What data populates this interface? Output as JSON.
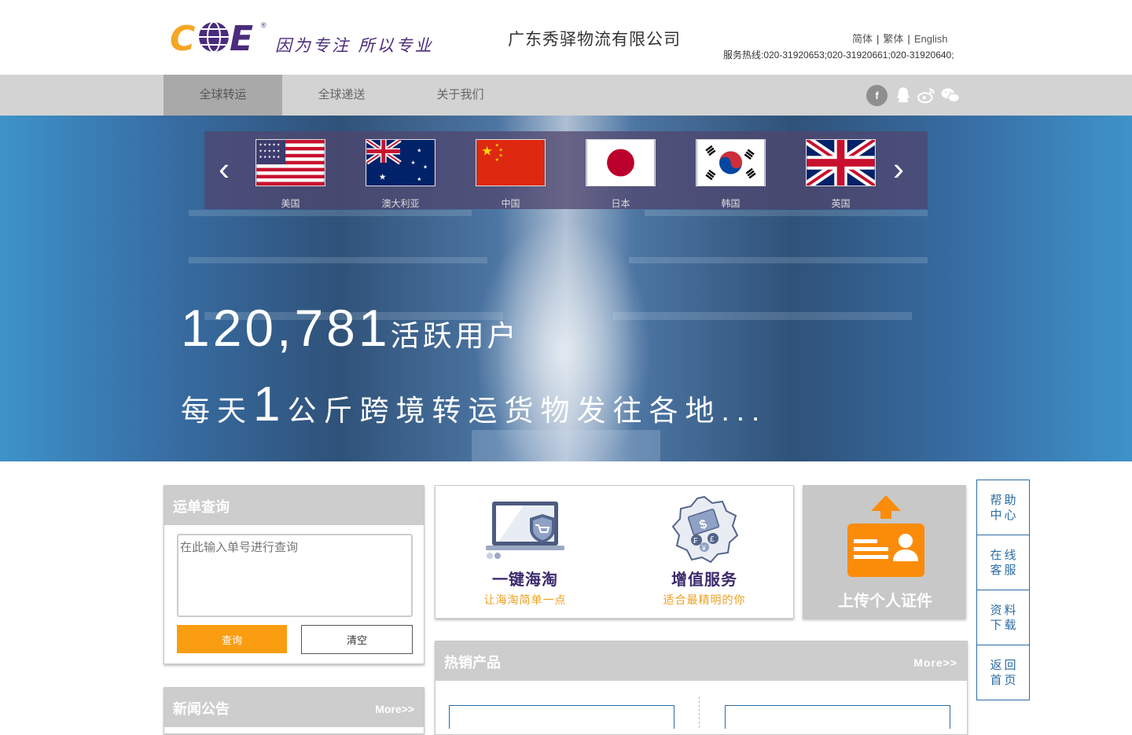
{
  "header": {
    "logo_text": "COE",
    "slogan": "因为专注 所以专业",
    "company_name": "广东秀驿物流有限公司",
    "languages": [
      "简体",
      "繁体",
      "English"
    ],
    "hotline": "服务热线:020-31920653;020-31920661;020-31920640;"
  },
  "nav": {
    "items": [
      "全球转运",
      "全球递送",
      "关于我们"
    ],
    "active_index": 0,
    "social_icons": [
      "facebook-icon",
      "qq-icon",
      "weibo-icon",
      "wechat-icon"
    ]
  },
  "banner": {
    "flags": [
      {
        "label": "美国",
        "icon": "us-flag"
      },
      {
        "label": "澳大利亚",
        "icon": "australia-flag"
      },
      {
        "label": "中国",
        "icon": "china-flag"
      },
      {
        "label": "日本",
        "icon": "japan-flag"
      },
      {
        "label": "韩国",
        "icon": "korea-flag"
      },
      {
        "label": "英国",
        "icon": "uk-flag"
      }
    ],
    "active_users": "120,781",
    "active_users_label": "活跃用户",
    "daily_prefix": "每天",
    "daily_number": "1",
    "daily_suffix": "公斤跨境转运货物发往各地..."
  },
  "tracking": {
    "title": "运单查询",
    "placeholder": "在此输入单号进行查询",
    "query_label": "查询",
    "clear_label": "清空"
  },
  "news": {
    "title": "新闻公告",
    "more_label": "More>>"
  },
  "services": [
    {
      "title": "一键海淘",
      "subtitle": "让海淘简单一点",
      "icon": "laptop-cart-icon"
    },
    {
      "title": "增值服务",
      "subtitle": "适合最精明的你",
      "icon": "currency-badge-icon"
    }
  ],
  "upload": {
    "label": "上传个人证件",
    "icon": "id-card-upload-icon"
  },
  "hot_products": {
    "title": "热销产品",
    "more_label": "More>>"
  },
  "side_bar": {
    "items": [
      "帮助中心",
      "在线客服",
      "资料下载",
      "返回首页"
    ]
  },
  "colors": {
    "brand_purple": "#4a2c7c",
    "accent_orange": "#fb9d10",
    "nav_bg": "#d3d3d3",
    "link_blue": "#2b6ca3"
  }
}
